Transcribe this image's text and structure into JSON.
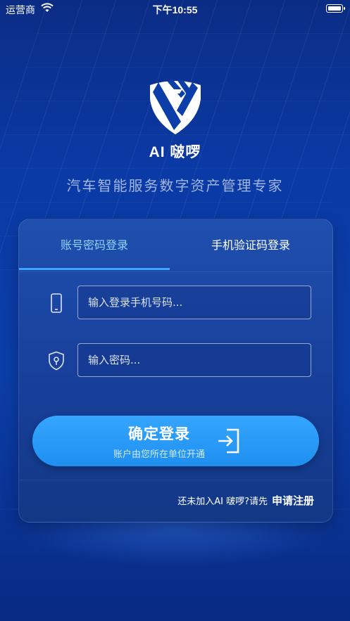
{
  "status_bar": {
    "carrier": "运营商",
    "time": "下午10:55"
  },
  "brand": {
    "app_name": "AI 啵啰",
    "tagline": "汽车智能服务数字资产管理专家"
  },
  "login": {
    "tabs": [
      {
        "label": "账号密码登录",
        "active": true
      },
      {
        "label": "手机验证码登录",
        "active": false
      }
    ],
    "phone_placeholder": "输入登录手机号码...",
    "password_placeholder": "输入密码...",
    "submit_label": "确定登录",
    "submit_sublabel": "账户由您所在单位开通",
    "footer_prompt": "还未加入AI 啵啰?请先",
    "register_label": "申请注册"
  },
  "colors": {
    "background": "#0a3aa6",
    "active_tab": "#8fd3ff",
    "tab_indicator": "#3aa6ff",
    "button": "#2b9bff"
  },
  "icons": [
    "wifi-icon",
    "battery-icon",
    "brand-logo",
    "phone-icon",
    "shield-lock-icon",
    "login-enter-icon"
  ]
}
